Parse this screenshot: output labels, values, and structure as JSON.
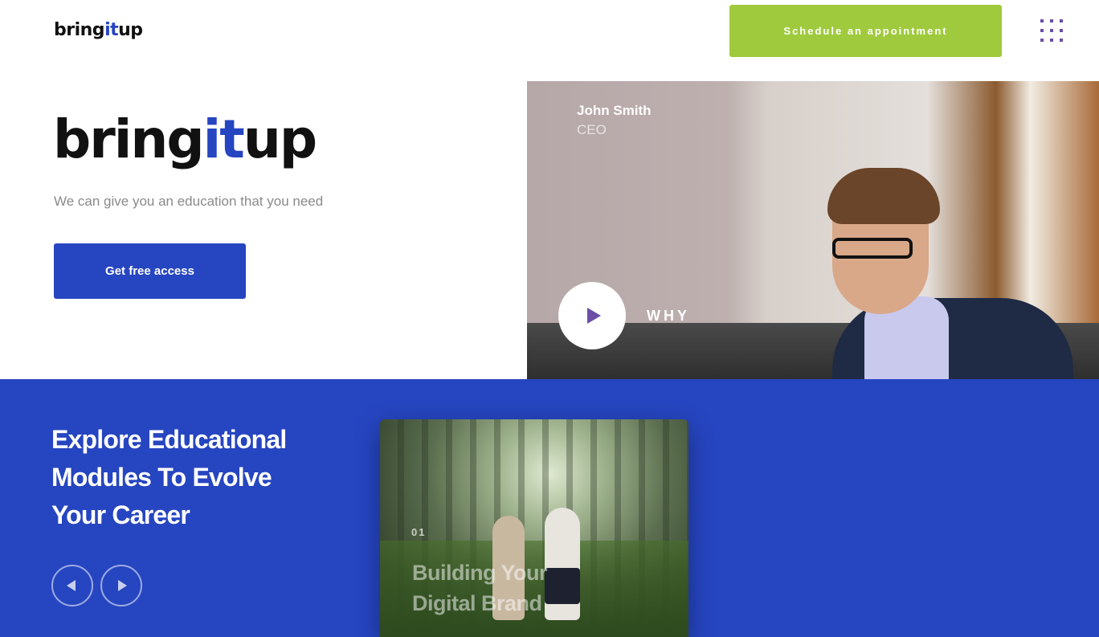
{
  "header": {
    "logo": {
      "part1": "bring",
      "accent": "it",
      "part2": "up"
    },
    "cta_label": "Schedule an appointment",
    "menu_icon": "grid-menu-icon"
  },
  "hero": {
    "logo": {
      "part1": "bring",
      "accent": "it",
      "part2": "up"
    },
    "tagline": "We can give you an education that you need",
    "button_label": "Get free access",
    "speaker": {
      "name": "John Smith",
      "role": "CEO"
    },
    "play_icon": "play-icon",
    "video_label": "WHY"
  },
  "modules": {
    "title_line1": "Explore Educational",
    "title_line2": "Modules To Evolve",
    "title_line3": "Your Career",
    "prev_icon": "arrow-left-icon",
    "next_icon": "arrow-right-icon",
    "card": {
      "number": "01",
      "title_line1": "Building Your",
      "title_line2": "Digital Brand"
    }
  },
  "colors": {
    "brand_blue": "#2645c0",
    "accent_green": "#9fca3d",
    "accent_purple": "#6b4fa6"
  }
}
